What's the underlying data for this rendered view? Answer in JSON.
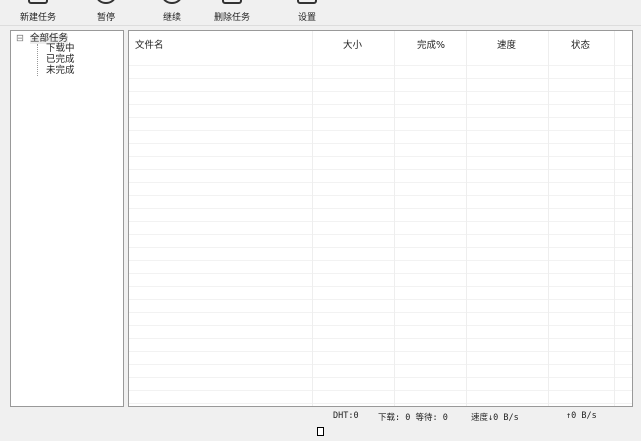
{
  "toolbar": {
    "new_task": "新建任务",
    "pause": "暂停",
    "resume": "继续",
    "delete_task": "删除任务",
    "settings": "设置"
  },
  "tree": {
    "root": "全部任务",
    "downloading": "下载中",
    "completed": "已完成",
    "incomplete": "未完成"
  },
  "table": {
    "columns": [
      "文件名",
      "大小",
      "完成%",
      "速度",
      "状态"
    ]
  },
  "status": {
    "dht": "DHT:0",
    "downloads": "下载: 0 等待: 0",
    "down_speed": "速度↓0 B/s",
    "up_speed": "↑0 B/s"
  }
}
